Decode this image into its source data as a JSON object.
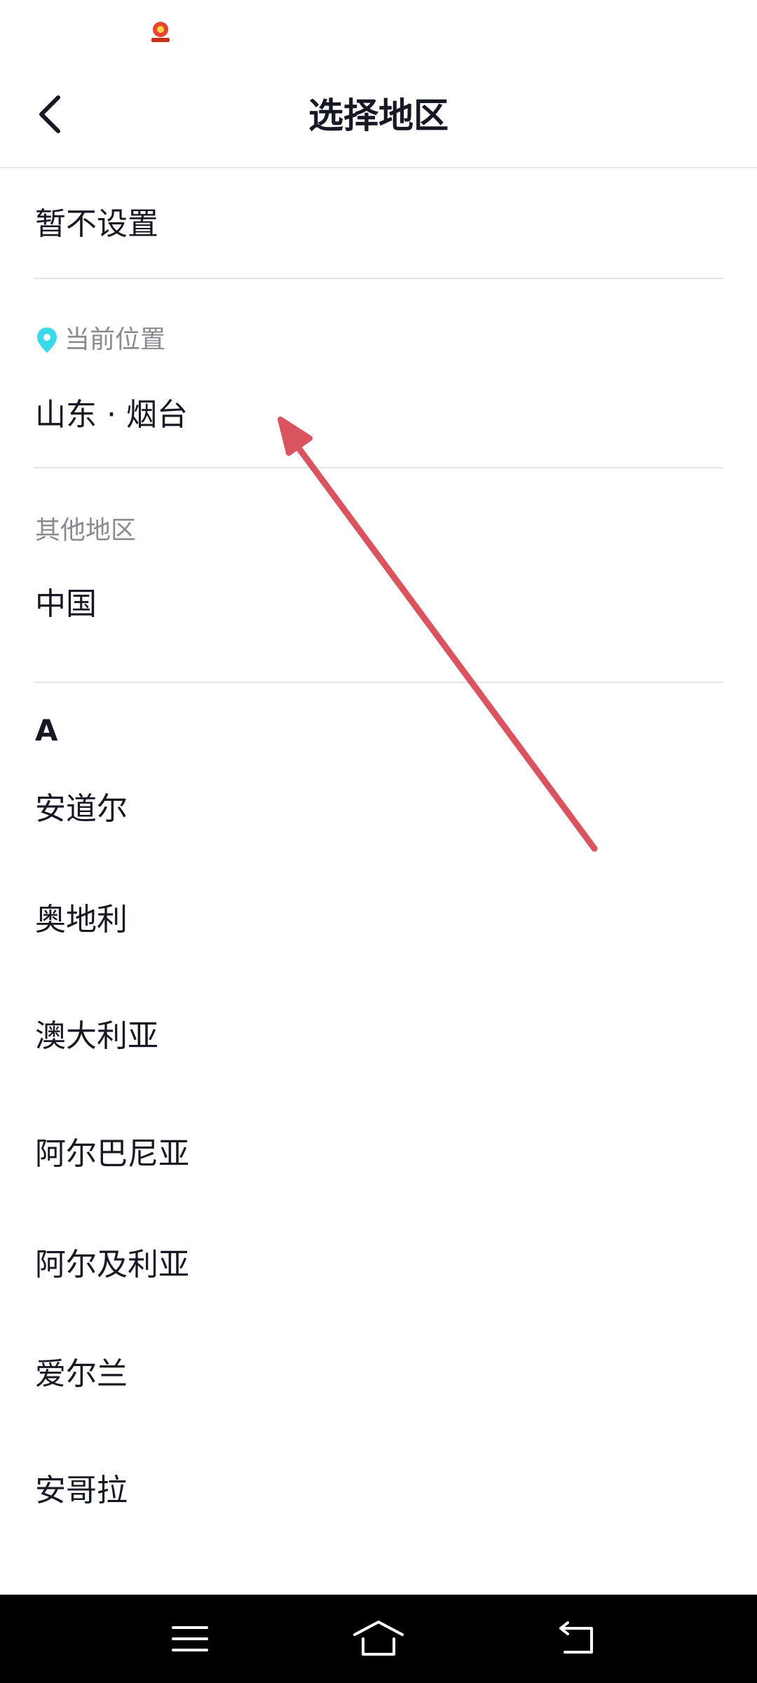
{
  "header": {
    "title": "选择地区",
    "back_icon": "chevron-left-icon"
  },
  "no_setting": {
    "label": "暂不设置"
  },
  "current_location": {
    "section_label": "当前位置",
    "icon": "location-pin-icon",
    "icon_color": "#37d9ea",
    "value": "山东 · 烟台"
  },
  "other_regions": {
    "section_label": "其他地区",
    "items": [
      "中国"
    ]
  },
  "index_group": {
    "letter": "A",
    "items": [
      "安道尔",
      "奥地利",
      "澳大利亚",
      "阿尔巴尼亚",
      "阿尔及利亚",
      "爱尔兰",
      "安哥拉"
    ]
  },
  "annotation": {
    "color": "#d9545f"
  },
  "nav": {
    "menu_icon": "menu-icon",
    "home_icon": "home-icon",
    "back_icon": "back-icon"
  }
}
